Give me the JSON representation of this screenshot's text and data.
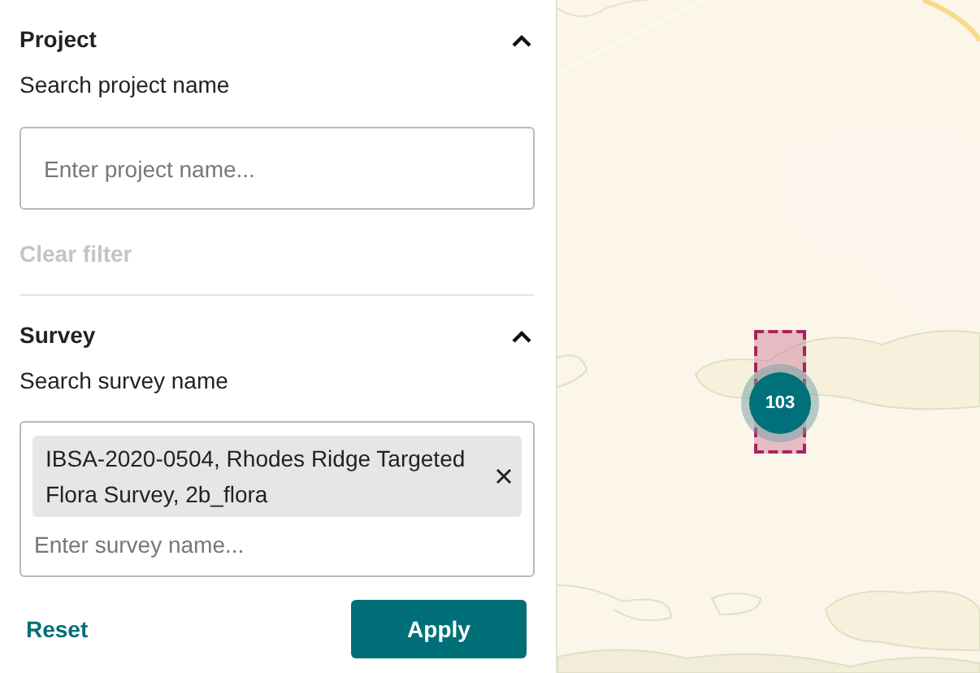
{
  "sections": [
    {
      "kind": "text",
      "title": "Project",
      "expanded": true,
      "label": "Search project name",
      "field": {
        "placeholder": "Enter project name..."
      },
      "clear": {
        "label": "Clear filter",
        "disabled": true
      }
    },
    {
      "kind": "chips",
      "title": "Survey",
      "expanded": true,
      "label": "Search survey name",
      "chips": [
        {
          "label": "IBSA-2020-0504, Rhodes Ridge Targeted Flora Survey, 2b_flora"
        }
      ],
      "field": {
        "placeholder": "Enter survey name..."
      }
    }
  ],
  "actions": {
    "reset": "Reset",
    "apply": "Apply"
  },
  "map": {
    "cluster": {
      "count": "103"
    }
  }
}
